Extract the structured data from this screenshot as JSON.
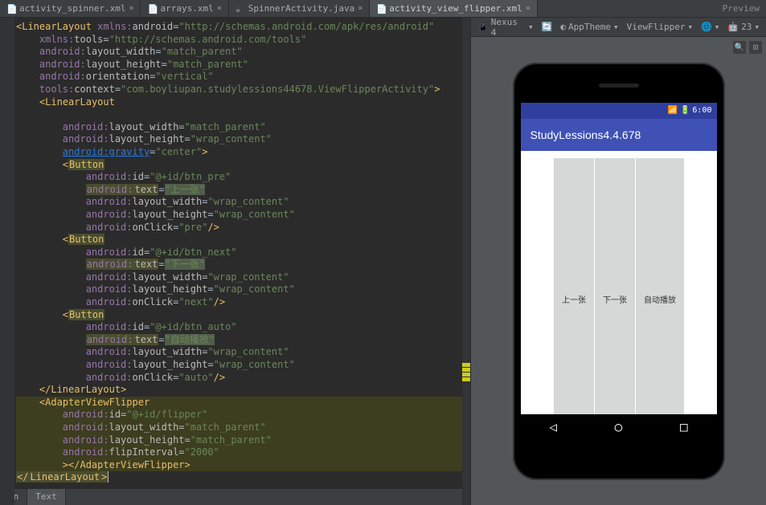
{
  "tabs": [
    {
      "label": "activity_spinner.xml"
    },
    {
      "label": "arrays.xml"
    },
    {
      "label": "SpinnerActivity.java"
    },
    {
      "label": "activity_view_flipper.xml"
    }
  ],
  "previewLabel": "Preview",
  "toolbar": {
    "device": "Nexus 4",
    "theme": "AppTheme",
    "viewClass": "ViewFlipper",
    "api": "23"
  },
  "statusBar": {
    "time": "6:00"
  },
  "appBar": {
    "title": "StudyLessions4.4.678"
  },
  "appButtons": {
    "prev": "上一张",
    "next": "下一张",
    "auto": "自动播放"
  },
  "bottomTabs": {
    "design": "gn",
    "text": "Text"
  },
  "code": {
    "ns_android": "\"http://schemas.android.com/apk/res/android\"",
    "ns_tools": "\"http://schemas.android.com/tools\"",
    "match_parent": "\"match_parent\"",
    "wrap_content": "\"wrap_content\"",
    "vertical": "\"vertical\"",
    "center": "\"center\"",
    "context": "\"com.boyliupan.studylessions44678.ViewFlipperActivity\"",
    "btn_pre": "\"@+id/btn_pre\"",
    "btn_next": "\"@+id/btn_next\"",
    "btn_auto": "\"@+id/btn_auto\"",
    "txt_pre": "\"上一张\"",
    "txt_next": "\"下一张\"",
    "txt_auto": "\"自动播放\"",
    "onclick_pre": "\"pre\"",
    "onclick_next": "\"next\"",
    "onclick_auto": "\"auto\"",
    "flipper_id": "\"@+id/flipper\"",
    "flip_interval": "\"2000\""
  }
}
